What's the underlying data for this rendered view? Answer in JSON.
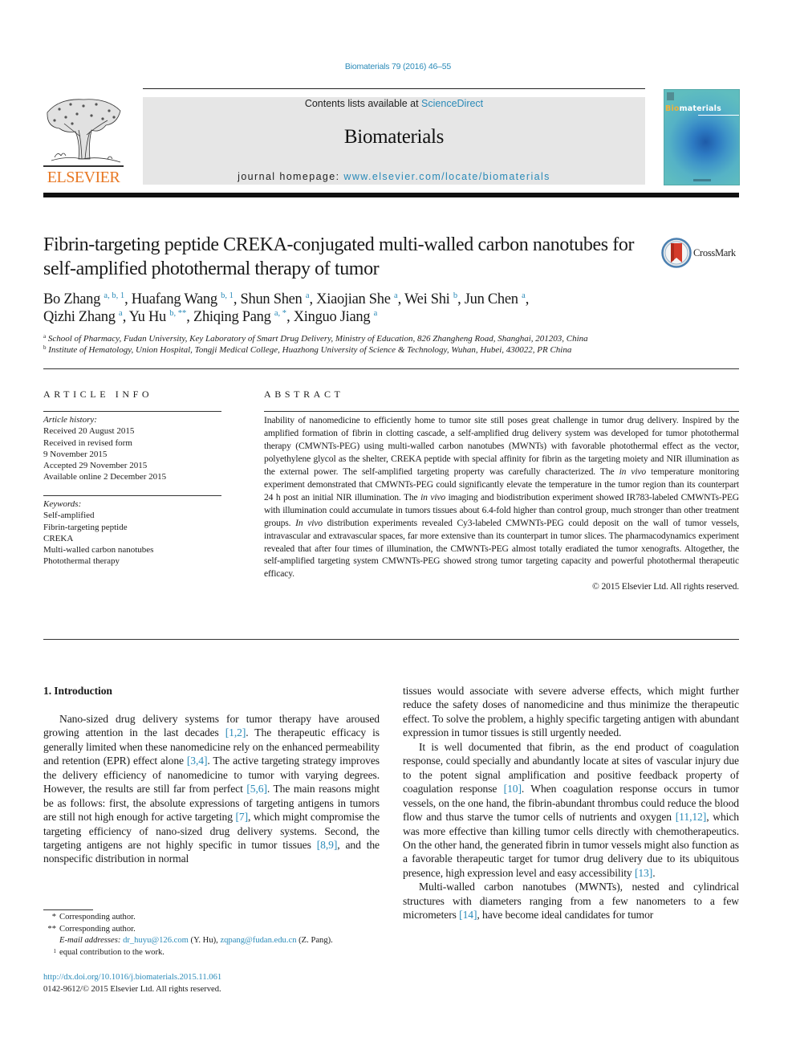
{
  "header": {
    "citation": "Biomaterials 79 (2016) 46–55",
    "contents_prefix": "Contents lists available at ",
    "contents_link": "ScienceDirect",
    "journal_name": "Biomaterials",
    "homepage_prefix": "journal homepage: ",
    "homepage_link": "www.elsevier.com/locate/biomaterials",
    "publisher_logo_text": "ELSEVIER",
    "cover_title_accent": "Bio",
    "cover_title_rest": "materials",
    "colors": {
      "link": "#2a8ab8",
      "elsevier_orange": "#e87722",
      "banner_bg": "#e6e6e6"
    }
  },
  "article": {
    "title": "Fibrin-targeting peptide CREKA-conjugated multi-walled carbon nanotubes for self-amplified photothermal therapy of tumor",
    "crossmark_label": "CrossMark",
    "authors": [
      {
        "name": "Bo Zhang",
        "sup": "a, b, 1",
        "sep": ", "
      },
      {
        "name": "Huafang Wang",
        "sup": "b, 1",
        "sep": ", "
      },
      {
        "name": "Shun Shen",
        "sup": "a",
        "sep": ", "
      },
      {
        "name": "Xiaojian She",
        "sup": "a",
        "sep": ", "
      },
      {
        "name": "Wei Shi",
        "sup": "b",
        "sep": ", "
      },
      {
        "name": "Jun Chen",
        "sup": "a",
        "sep": ","
      },
      {
        "name": "Qizhi Zhang",
        "sup": "a",
        "sep": ", "
      },
      {
        "name": "Yu Hu",
        "sup": "b, **",
        "sep": ", "
      },
      {
        "name": "Zhiqing Pang",
        "sup": "a, *",
        "sep": ", "
      },
      {
        "name": "Xinguo Jiang",
        "sup": "a",
        "sep": ""
      }
    ],
    "affiliations": [
      {
        "mark": "a",
        "text": "School of Pharmacy, Fudan University, Key Laboratory of Smart Drug Delivery, Ministry of Education, 826 Zhangheng Road, Shanghai, 201203, China"
      },
      {
        "mark": "b",
        "text": "Institute of Hematology, Union Hospital, Tongji Medical College, Huazhong University of Science & Technology, Wuhan, Hubei, 430022, PR China"
      }
    ]
  },
  "article_info": {
    "heading": "ARTICLE INFO",
    "history_label": "Article history:",
    "history": [
      "Received 20 August 2015",
      "Received in revised form",
      "9 November 2015",
      "Accepted 29 November 2015",
      "Available online 2 December 2015"
    ],
    "keywords_label": "Keywords:",
    "keywords": [
      "Self-amplified",
      "Fibrin-targeting peptide",
      "CREKA",
      "Multi-walled carbon nanotubes",
      "Photothermal therapy"
    ]
  },
  "abstract": {
    "heading": "ABSTRACT",
    "segments": [
      {
        "t": "Inability of nanomedicine to efficiently home to tumor site still poses great challenge in tumor drug delivery. Inspired by the amplified formation of fibrin in clotting cascade, a self-amplified drug delivery system was developed for tumor photothermal therapy (CMWNTs-PEG) using multi-walled carbon nanotubes (MWNTs) with favorable photothermal effect as the vector, polyethylene glycol as the shelter, CREKA peptide with special affinity for fibrin as the targeting moiety and NIR illumination as the external power. The self-amplified targeting property was carefully characterized. The ",
        "i": false
      },
      {
        "t": "in vivo",
        "i": true
      },
      {
        "t": " temperature monitoring experiment demonstrated that CMWNTs-PEG could significantly elevate the temperature in the tumor region than its counterpart 24 h post an initial NIR illumination. The ",
        "i": false
      },
      {
        "t": "in vivo",
        "i": true
      },
      {
        "t": " imaging and biodistribution experiment showed IR783-labeled CMWNTs-PEG with illumination could accumulate in tumors tissues about 6.4-fold higher than control group, much stronger than other treatment groups. ",
        "i": false
      },
      {
        "t": "In vivo",
        "i": true
      },
      {
        "t": " distribution experiments revealed Cy3-labeled CMWNTs-PEG could deposit on the wall of tumor vessels, intravascular and extravascular spaces, far more extensive than its counterpart in tumor slices. The pharmacodynamics experiment revealed that after four times of illumination, the CMWNTs-PEG almost totally eradiated the tumor xenografts. Altogether, the self-amplified targeting system CMWNTs-PEG showed strong tumor targeting capacity and powerful photothermal therapeutic efficacy.",
        "i": false
      }
    ],
    "copyright": "© 2015 Elsevier Ltd. All rights reserved."
  },
  "body": {
    "section_heading": "1.  Introduction",
    "left_paragraphs": [
      [
        {
          "t": "Nano-sized drug delivery systems for tumor therapy have aroused growing attention in the last decades "
        },
        {
          "t": "[1,2]",
          "ref": true
        },
        {
          "t": ". The therapeutic efficacy is generally limited when these nanomedicine rely on the enhanced permeability and retention (EPR) effect alone "
        },
        {
          "t": "[3,4]",
          "ref": true
        },
        {
          "t": ". The active targeting strategy improves the delivery efficiency of nano­medicine to tumor with varying degrees. However, the results are still far from perfect "
        },
        {
          "t": "[5,6]",
          "ref": true
        },
        {
          "t": ". The main reasons might be as follows: first, the absolute expressions of targeting antigens in tumors are still not high enough for active targeting "
        },
        {
          "t": "[7]",
          "ref": true
        },
        {
          "t": ", which might compromise the targeting efficiency of nano-sized drug delivery systems. Second, the targeting antigens are not highly specific in tumor tissues "
        },
        {
          "t": "[8,9]",
          "ref": true
        },
        {
          "t": ", and the nonspecific distribution in normal"
        }
      ]
    ],
    "right_paragraphs": [
      {
        "indent": false,
        "segments": [
          {
            "t": "tissues would associate with severe adverse effects, which might further reduce the safety doses of nanomedicine and thus minimize the therapeutic effect. To solve the problem, a highly specific tar­geting antigen with abundant expression in tumor tissues is still urgently needed."
          }
        ]
      },
      {
        "indent": true,
        "segments": [
          {
            "t": "It is well documented that fibrin, as the end product of coagulation response, could specially and abundantly locate at sites of vascular injury due to the potent signal amplification and positive feedback property of coagulation response "
          },
          {
            "t": "[10]",
            "ref": true
          },
          {
            "t": ". When coagulation response occurs in tumor vessels, on the one hand, the fibrin-abundant thrombus could reduce the blood flow and thus starve the tumor cells of nutrients and oxygen "
          },
          {
            "t": "[11,12]",
            "ref": true
          },
          {
            "t": ", which was more effective than killing tumor cells directly with chemotherapeutics. On the other hand, the generated fibrin in tumor vessels might also function as a favorable therapeutic target for tumor drug delivery due to its ubiq­uitous presence, high expression level and easy accessibility "
          },
          {
            "t": "[13]",
            "ref": true
          },
          {
            "t": "."
          }
        ]
      },
      {
        "indent": true,
        "segments": [
          {
            "t": "Multi-walled carbon nanotubes (MWNTs), nested and cylindri­cal structures with diameters ranging from a few nanometers to a few micrometers "
          },
          {
            "t": "[14]",
            "ref": true
          },
          {
            "t": ", have become ideal candidates for tumor"
          }
        ]
      }
    ]
  },
  "footnotes": {
    "items": [
      {
        "mark": "*",
        "text": "Corresponding author."
      },
      {
        "mark": "**",
        "text": "Corresponding author."
      }
    ],
    "email_label": "E-mail addresses:",
    "email1": "dr_huyu@126.com",
    "email1_owner": " (Y. Hu), ",
    "email2": "zqpang@fudan.edu.cn",
    "email2_owner": " (Z. Pang).",
    "equal_mark": "1",
    "equal_text": "equal contribution to the work.",
    "doi_link": "http://dx.doi.org/10.1016/j.biomaterials.2015.11.061",
    "issn_line": "0142-9612/© 2015 Elsevier Ltd. All rights reserved."
  }
}
